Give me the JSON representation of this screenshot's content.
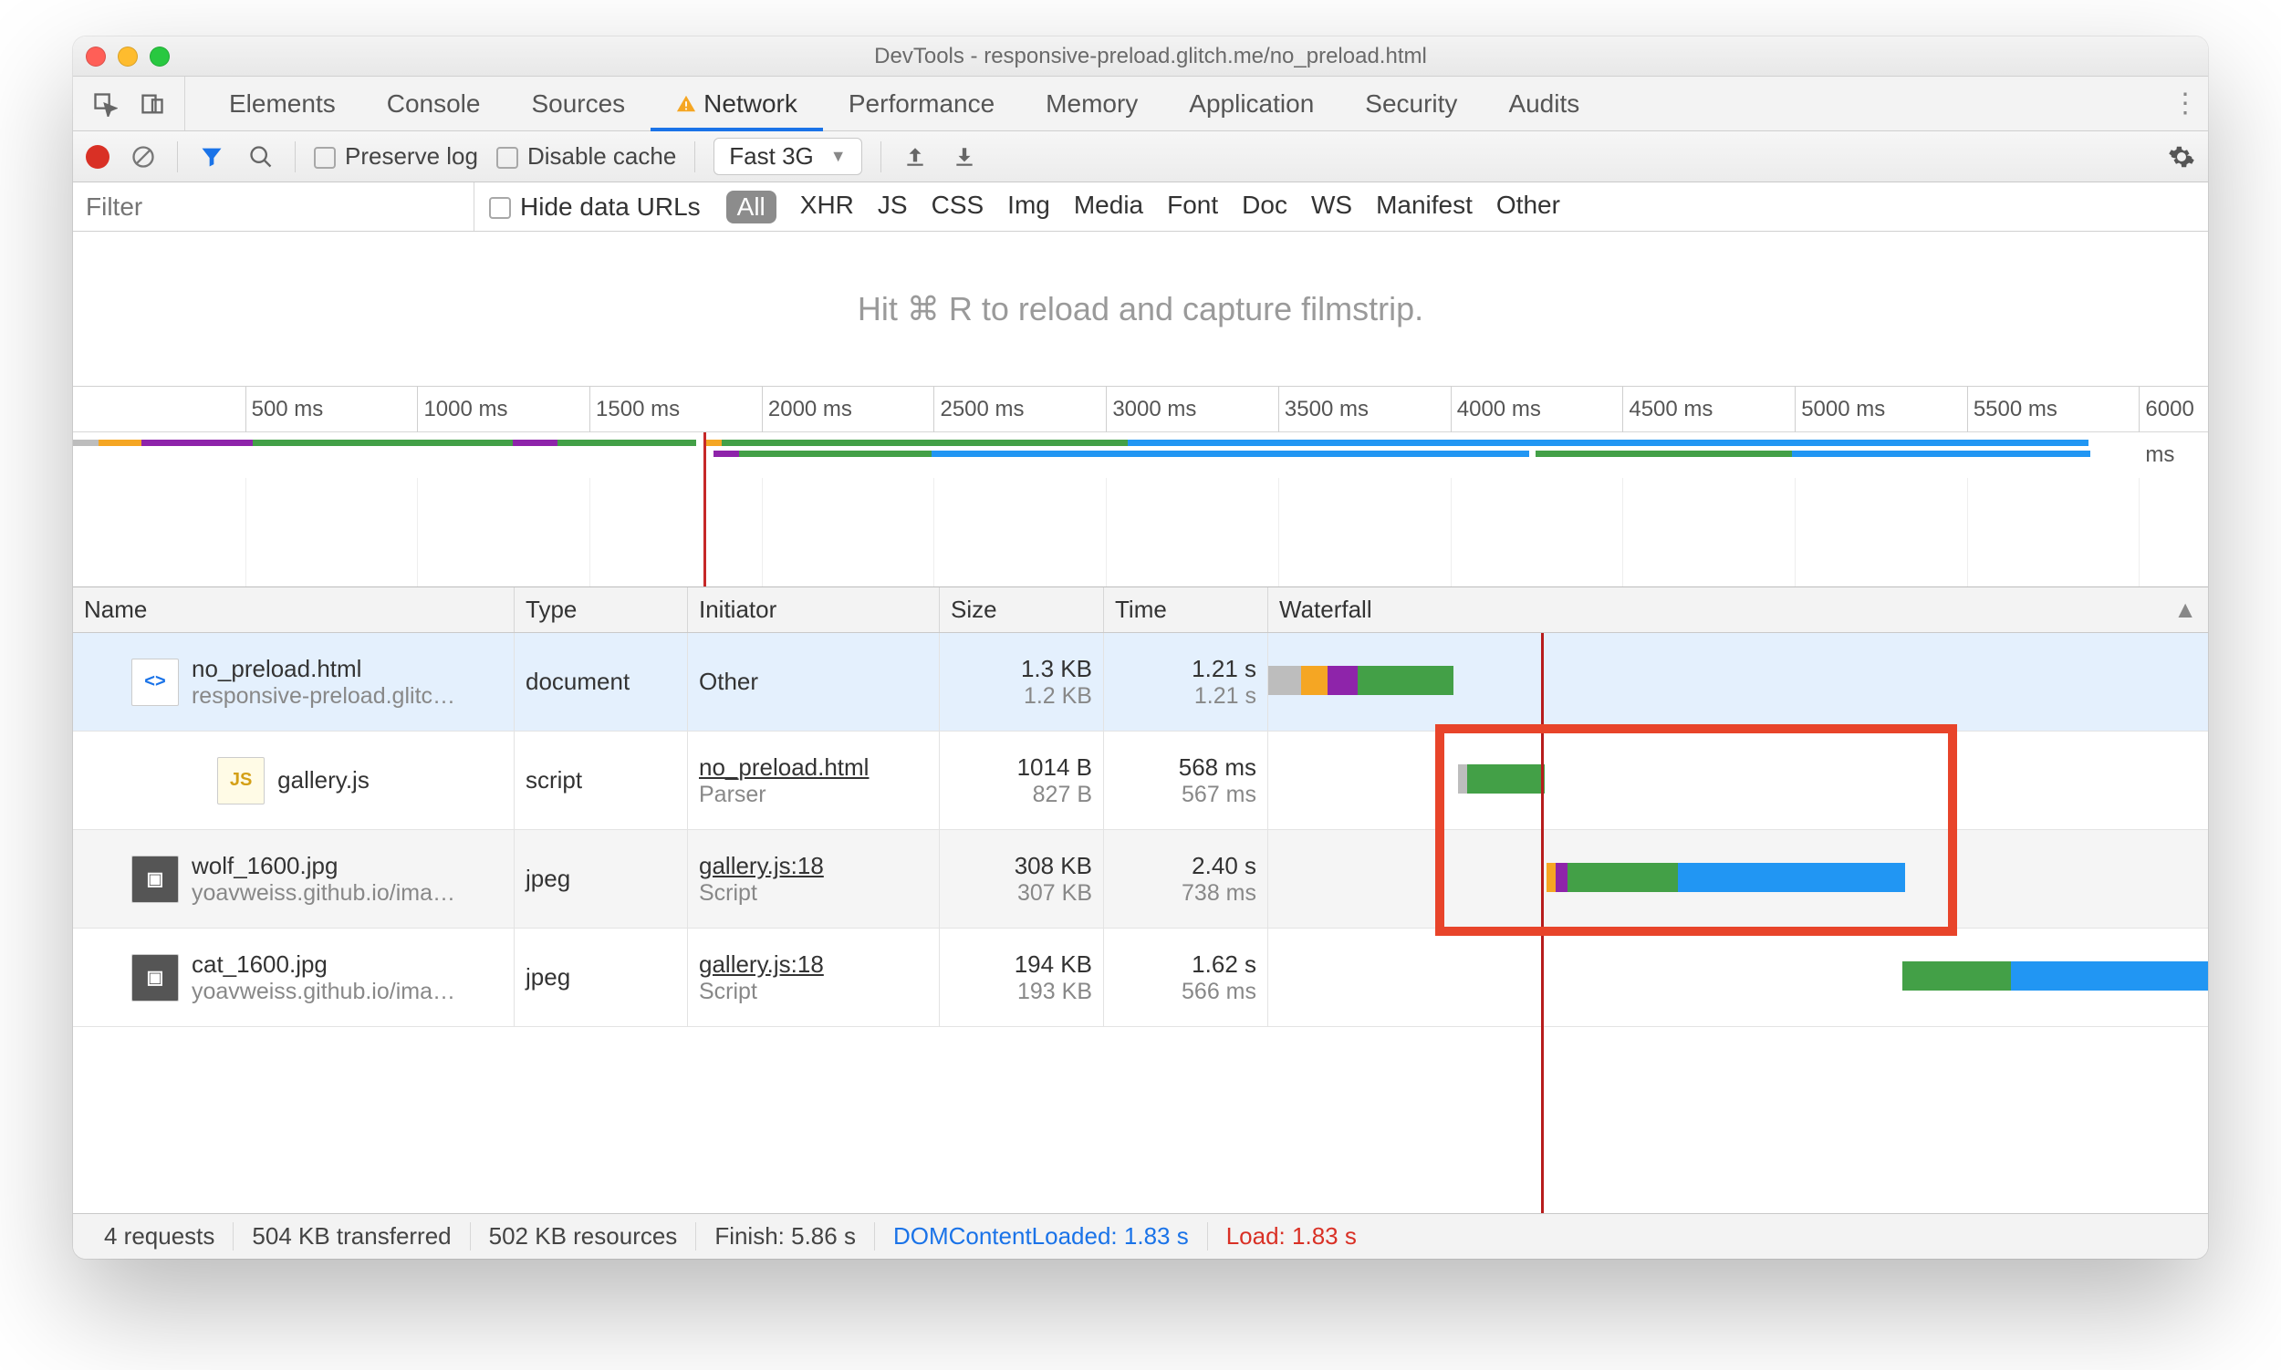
{
  "window": {
    "title": "DevTools - responsive-preload.glitch.me/no_preload.html"
  },
  "tabs": {
    "items": [
      "Elements",
      "Console",
      "Sources",
      "Network",
      "Performance",
      "Memory",
      "Application",
      "Security",
      "Audits"
    ],
    "active": "Network",
    "warning_on": "Network"
  },
  "toolbar": {
    "preserve_log": "Preserve log",
    "disable_cache": "Disable cache",
    "throttle": "Fast 3G"
  },
  "filterbar": {
    "placeholder": "Filter",
    "hide_data_urls": "Hide data URLs",
    "types": [
      "All",
      "XHR",
      "JS",
      "CSS",
      "Img",
      "Media",
      "Font",
      "Doc",
      "WS",
      "Manifest",
      "Other"
    ],
    "active": "All"
  },
  "filmstrip": {
    "hint": "Hit ⌘ R to reload and capture filmstrip."
  },
  "overview": {
    "ticks": [
      "500 ms",
      "1000 ms",
      "1500 ms",
      "2000 ms",
      "2500 ms",
      "3000 ms",
      "3500 ms",
      "4000 ms",
      "4500 ms",
      "5000 ms",
      "5500 ms",
      "6000 ms"
    ],
    "tick_positions_pct": [
      8.06,
      16.13,
      24.19,
      32.26,
      40.32,
      48.39,
      56.45,
      64.52,
      72.58,
      80.65,
      88.71,
      96.77
    ],
    "dcl_pct": 29.52,
    "bars": [
      {
        "row": 0,
        "segments": [
          {
            "start": 0,
            "width": 1.2,
            "color": "#bdbdbd"
          },
          {
            "start": 1.2,
            "width": 2.0,
            "color": "#f5a623"
          },
          {
            "start": 3.2,
            "width": 5.2,
            "color": "#8e24aa"
          },
          {
            "start": 8.4,
            "width": 11.5,
            "color": "#43a047"
          },
          {
            "start": 19.9,
            "width": 0.7,
            "color": "#43a047"
          },
          {
            "start": 20.6,
            "width": 2.1,
            "color": "#8e24aa"
          },
          {
            "start": 22.7,
            "width": 6.5,
            "color": "#43a047"
          },
          {
            "start": 29.6,
            "width": 0.8,
            "color": "#f5a623"
          },
          {
            "start": 30.4,
            "width": 19.0,
            "color": "#43a047"
          },
          {
            "start": 49.4,
            "width": 45.0,
            "color": "#2196f3"
          }
        ]
      },
      {
        "row": 1,
        "segments": [
          {
            "start": 30.0,
            "width": 1.2,
            "color": "#8e24aa"
          },
          {
            "start": 31.2,
            "width": 9.0,
            "color": "#43a047"
          },
          {
            "start": 40.2,
            "width": 28.0,
            "color": "#2196f3"
          },
          {
            "start": 68.5,
            "width": 12.0,
            "color": "#43a047"
          },
          {
            "start": 80.5,
            "width": 14.0,
            "color": "#2196f3"
          }
        ]
      }
    ]
  },
  "columns": {
    "name": "Name",
    "type": "Type",
    "initiator": "Initiator",
    "size": "Size",
    "time": "Time",
    "waterfall": "Waterfall"
  },
  "requests": [
    {
      "name": "no_preload.html",
      "sub": "responsive-preload.glitc…",
      "icon": "html",
      "type": "document",
      "initiator": "Other",
      "initiator_sub": "",
      "size": "1.3 KB",
      "size_sub": "1.2 KB",
      "time": "1.21 s",
      "time_sub": "1.21 s",
      "selected": true,
      "wf": [
        {
          "start": 0,
          "width": 3.5,
          "color": "#bdbdbd"
        },
        {
          "start": 3.5,
          "width": 2.8,
          "color": "#f5a623"
        },
        {
          "start": 6.3,
          "width": 3.2,
          "color": "#8e24aa"
        },
        {
          "start": 9.5,
          "width": 10.2,
          "color": "#43a047"
        }
      ]
    },
    {
      "name": "gallery.js",
      "sub": "",
      "icon": "js",
      "type": "script",
      "initiator": "no_preload.html",
      "initiator_sub": "Parser",
      "initiator_link": true,
      "size": "1014 B",
      "size_sub": "827 B",
      "time": "568 ms",
      "time_sub": "567 ms",
      "wf": [
        {
          "start": 20.2,
          "width": 1.0,
          "color": "#bdbdbd"
        },
        {
          "start": 21.2,
          "width": 8.2,
          "color": "#43a047"
        }
      ]
    },
    {
      "name": "wolf_1600.jpg",
      "sub": "yoavweiss.github.io/ima…",
      "icon": "img",
      "type": "jpeg",
      "initiator": "gallery.js:18",
      "initiator_sub": "Script",
      "initiator_link": true,
      "size": "308 KB",
      "size_sub": "307 KB",
      "time": "2.40 s",
      "time_sub": "738 ms",
      "wf": [
        {
          "start": 29.6,
          "width": 1.0,
          "color": "#f5a623"
        },
        {
          "start": 30.6,
          "width": 1.2,
          "color": "#8e24aa"
        },
        {
          "start": 31.8,
          "width": 11.8,
          "color": "#43a047"
        },
        {
          "start": 43.6,
          "width": 24.2,
          "color": "#2196f3"
        }
      ]
    },
    {
      "name": "cat_1600.jpg",
      "sub": "yoavweiss.github.io/ima…",
      "icon": "img",
      "type": "jpeg",
      "initiator": "gallery.js:18",
      "initiator_sub": "Script",
      "initiator_link": true,
      "size": "194 KB",
      "size_sub": "193 KB",
      "time": "1.62 s",
      "time_sub": "566 ms",
      "wf": [
        {
          "start": 67.5,
          "width": 11.5,
          "color": "#43a047"
        },
        {
          "start": 79.0,
          "width": 21.0,
          "color": "#2196f3"
        }
      ]
    }
  ],
  "waterfall_vline_pct": 29.0,
  "highlight": {
    "left_pct": 17.8,
    "width_pct": 55.5,
    "top_row": 1,
    "rows": 2
  },
  "status": {
    "requests": "4 requests",
    "transferred": "504 KB transferred",
    "resources": "502 KB resources",
    "finish": "Finish: 5.86 s",
    "dcl": "DOMContentLoaded: 1.83 s",
    "load": "Load: 1.83 s"
  }
}
